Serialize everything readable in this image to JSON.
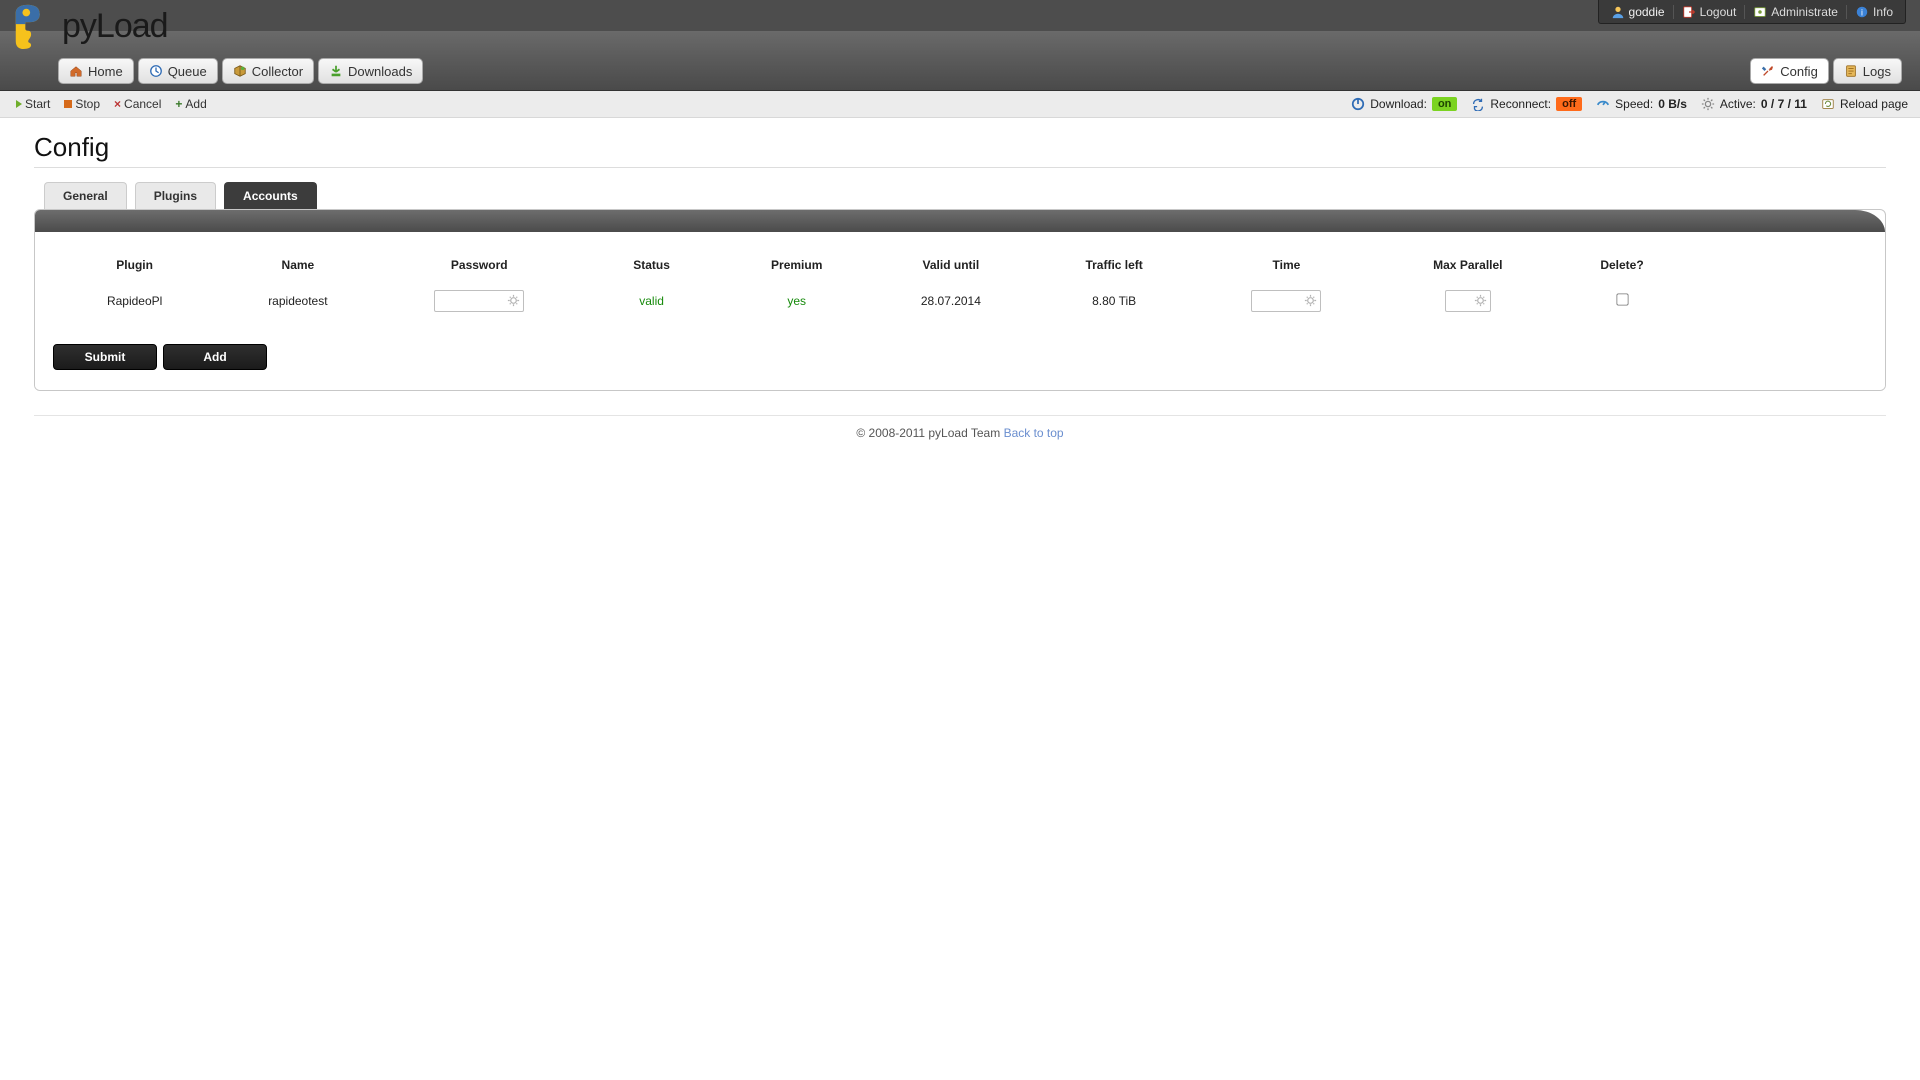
{
  "brand": "pyLoad",
  "user": {
    "name": "goddie",
    "logout": "Logout",
    "administrate": "Administrate",
    "info": "Info"
  },
  "nav": {
    "home": "Home",
    "queue": "Queue",
    "collector": "Collector",
    "downloads": "Downloads",
    "config": "Config",
    "logs": "Logs"
  },
  "toolbar": {
    "start": "Start",
    "stop": "Stop",
    "cancel": "Cancel",
    "add": "Add",
    "download_label": "Download:",
    "download_state": "on",
    "reconnect_label": "Reconnect:",
    "reconnect_state": "off",
    "speed_label": "Speed:",
    "speed_value": "0 B/s",
    "active_label": "Active:",
    "active_value": "0 / 7 / 11",
    "reload": "Reload page"
  },
  "page": {
    "title": "Config"
  },
  "tabs": {
    "general": "General",
    "plugins": "Plugins",
    "accounts": "Accounts"
  },
  "table": {
    "headers": {
      "plugin": "Plugin",
      "name": "Name",
      "password": "Password",
      "status": "Status",
      "premium": "Premium",
      "valid_until": "Valid until",
      "traffic_left": "Traffic left",
      "time": "Time",
      "max_parallel": "Max Parallel",
      "delete": "Delete?"
    },
    "row": {
      "plugin": "RapideoPl",
      "name": "rapideotest",
      "status": "valid",
      "premium": "yes",
      "valid_until": "28.07.2014",
      "traffic_left": "8.80 TiB"
    }
  },
  "buttons": {
    "submit": "Submit",
    "add": "Add"
  },
  "footer": {
    "copyright": "© 2008-2011 pyLoad Team",
    "back": "Back to top"
  }
}
